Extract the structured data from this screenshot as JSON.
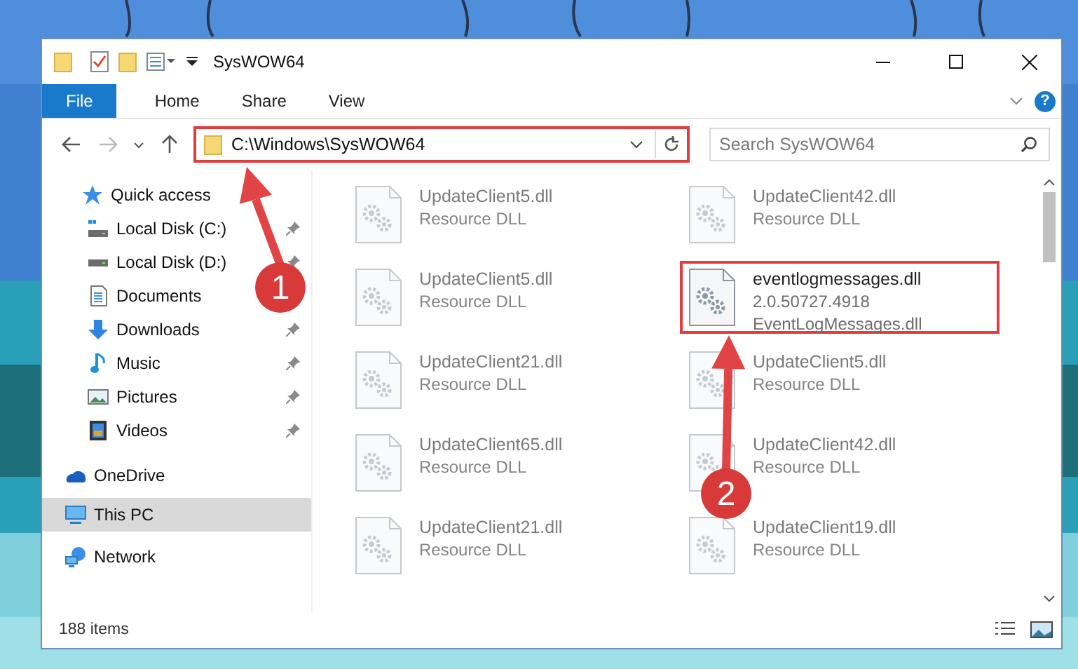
{
  "window": {
    "title": "SysWOW64"
  },
  "ribbon": {
    "tabs": [
      {
        "label": "File",
        "kind": "file",
        "selected": false
      },
      {
        "label": "Home",
        "kind": "tab",
        "selected": false
      },
      {
        "label": "Share",
        "kind": "tab",
        "selected": false
      },
      {
        "label": "View",
        "kind": "tab",
        "selected": false
      }
    ],
    "help": "?"
  },
  "address_bar": {
    "path": "C:\\Windows\\SysWOW64",
    "highlighted": true
  },
  "search": {
    "placeholder": "Search SysWOW64"
  },
  "sidebar": {
    "items": [
      {
        "label": "Quick access",
        "selected": false,
        "children": [
          {
            "label": "Local Disk (C:)",
            "selected": false,
            "pinned": true
          },
          {
            "label": "Local Disk (D:)",
            "selected": false,
            "pinned": true
          },
          {
            "label": "Documents",
            "selected": false
          },
          {
            "label": "Downloads",
            "selected": false,
            "pinned": true
          },
          {
            "label": "Music",
            "selected": false,
            "pinned": true
          },
          {
            "label": "Pictures",
            "selected": false,
            "pinned": true
          },
          {
            "label": "Videos",
            "selected": false,
            "pinned": true
          }
        ]
      },
      {
        "label": "OneDrive",
        "selected": false
      },
      {
        "label": "This PC",
        "selected": true
      },
      {
        "label": "Network",
        "selected": false
      }
    ]
  },
  "files": [
    {
      "name": "UpdateClient5.dll",
      "details": [
        "Resource DLL"
      ],
      "blurred": true,
      "highlighted": false
    },
    {
      "name": "UpdateClient42.dll",
      "details": [
        "Resource DLL"
      ],
      "blurred": true,
      "highlighted": false
    },
    {
      "name": "UpdateClient5.dll",
      "details": [
        "Resource DLL"
      ],
      "blurred": true,
      "highlighted": false
    },
    {
      "name": "eventlogmessages.dll",
      "details": [
        "2.0.50727.4918",
        "EventLogMessages.dll"
      ],
      "blurred": false,
      "highlighted": true
    },
    {
      "name": "UpdateClient21.dll",
      "details": [
        "Resource DLL"
      ],
      "blurred": true,
      "highlighted": false
    },
    {
      "name": "UpdateClient5.dll",
      "details": [
        "Resource DLL"
      ],
      "blurred": true,
      "highlighted": false
    },
    {
      "name": "UpdateClient65.dll",
      "details": [
        "Resource DLL"
      ],
      "blurred": true,
      "highlighted": false
    },
    {
      "name": "UpdateClient42.dll",
      "details": [
        "Resource DLL"
      ],
      "blurred": true,
      "highlighted": false
    },
    {
      "name": "UpdateClient21.dll",
      "details": [
        "Resource DLL"
      ],
      "blurred": true,
      "highlighted": false
    },
    {
      "name": "UpdateClient19.dll",
      "details": [
        "Resource DLL"
      ],
      "blurred": true,
      "highlighted": false
    }
  ],
  "status_bar": {
    "item_count": "188 items"
  },
  "annotations": [
    {
      "label": "1"
    },
    {
      "label": "2"
    }
  ]
}
